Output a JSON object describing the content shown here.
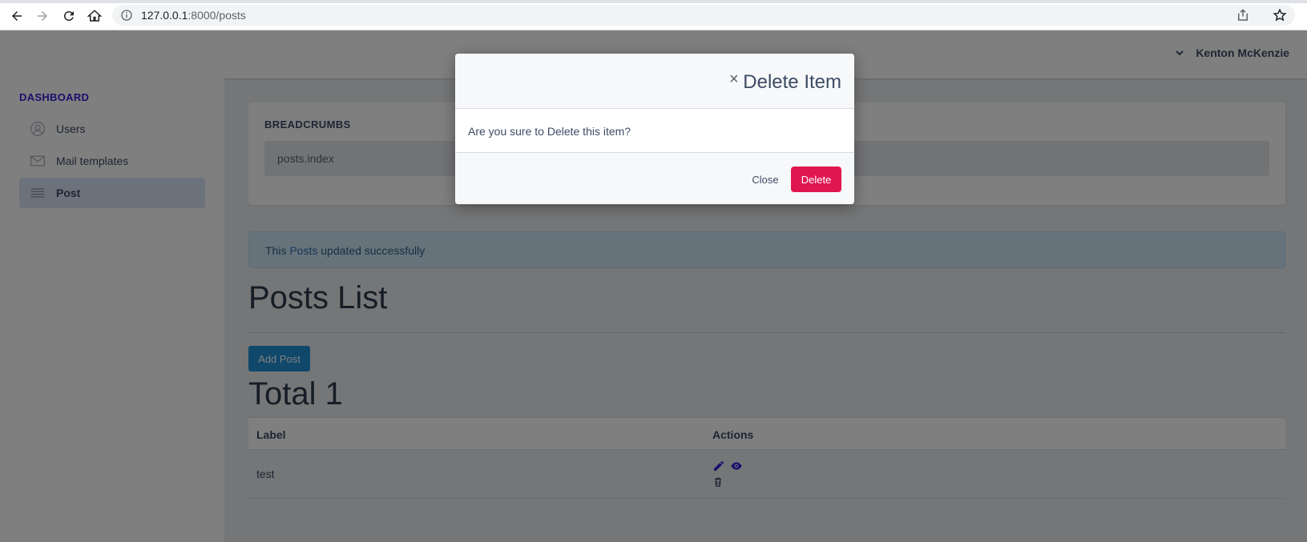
{
  "browser": {
    "url_host": "127.0.0.1",
    "url_rest": ":8000/posts"
  },
  "header": {
    "user_name": "Kenton McKenzie"
  },
  "sidebar": {
    "title": "DASHBOARD",
    "items": [
      {
        "label": "Users",
        "icon": "user-icon"
      },
      {
        "label": "Mail templates",
        "icon": "envelope-icon"
      },
      {
        "label": "Post",
        "icon": "list-icon",
        "active": true
      }
    ]
  },
  "breadcrumbs": {
    "title": "BREADCRUMBS",
    "path": "posts.index"
  },
  "alert": {
    "prefix": "This",
    "link": "Posts",
    "suffix": "updated successfully"
  },
  "main": {
    "heading": "Posts List",
    "add_button": "Add Post",
    "total": "Total 1"
  },
  "table": {
    "headers": [
      "Label",
      "Actions"
    ],
    "rows": [
      {
        "label": "test"
      }
    ]
  },
  "modal": {
    "title": "Delete Item",
    "close_symbol": "×",
    "message": "Are you sure to Delete this item?",
    "close_button": "Close",
    "delete_button": "Delete"
  },
  "colors": {
    "primary": "#321fdb",
    "info_button": "#1e90d6",
    "danger": "#e0174f",
    "alert_bg": "#cfe6f5"
  }
}
